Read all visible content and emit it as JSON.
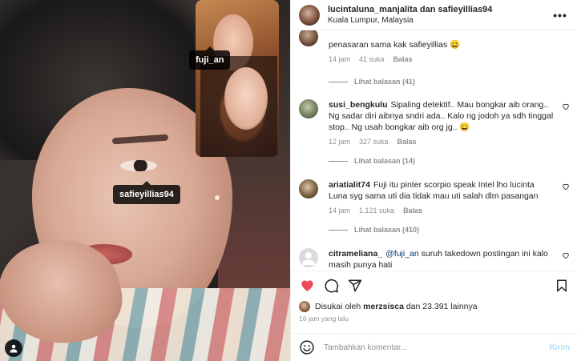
{
  "photo": {
    "tags": [
      {
        "label": "fuji_an"
      },
      {
        "label": "safieyillias94"
      }
    ]
  },
  "header": {
    "owner": "lucintaluna_manjalita dan safieyillias94",
    "location": "Kuala Lumpur, Malaysia",
    "more_label": "•••"
  },
  "comments": [
    {
      "text": "penasaran sama kak safieyillias 😀",
      "time": "14 jam",
      "likes": "41 suka",
      "reply": "Balas",
      "view_replies": "Lihat balasan (41)"
    },
    {
      "user": "susi_bengkulu",
      "text": "Sipaling detektif.. Mau bongkar aib orang.. Ng sadar diri aibnya sndri ada.. Kalo ng jodoh ya sdh tinggal stop.. Ng usah bongkar aib org jg.. 😀",
      "time": "12 jam",
      "likes": "327 suka",
      "reply": "Balas",
      "view_replies": "Lihat balasan (14)"
    },
    {
      "user": "ariatialit74",
      "text": "Fuji itu pinter scorpio speak Intel lho lucinta Luna syg sama uti dia tidak mau uti salah dlm pasangan",
      "time": "14 jam",
      "likes": "1,121 suka",
      "reply": "Balas",
      "view_replies": "Lihat balasan (410)"
    },
    {
      "user": "citrameliana_",
      "mention": "@fuji_an",
      "text": "suruh takedown postingan ini kalo masih punya hati"
    }
  ],
  "liked_by": {
    "prefix": "Disukai oleh",
    "user": "merzsisca",
    "suffix": "dan 23.391 lainnya"
  },
  "time_ago": "16 jam yang lalu",
  "add_comment": {
    "placeholder": "Tambahkan komentar...",
    "post_label": "Kirim"
  },
  "colors": {
    "like_red": "#ed4956",
    "link_blue": "#00376b",
    "muted": "#8e8e8e"
  }
}
